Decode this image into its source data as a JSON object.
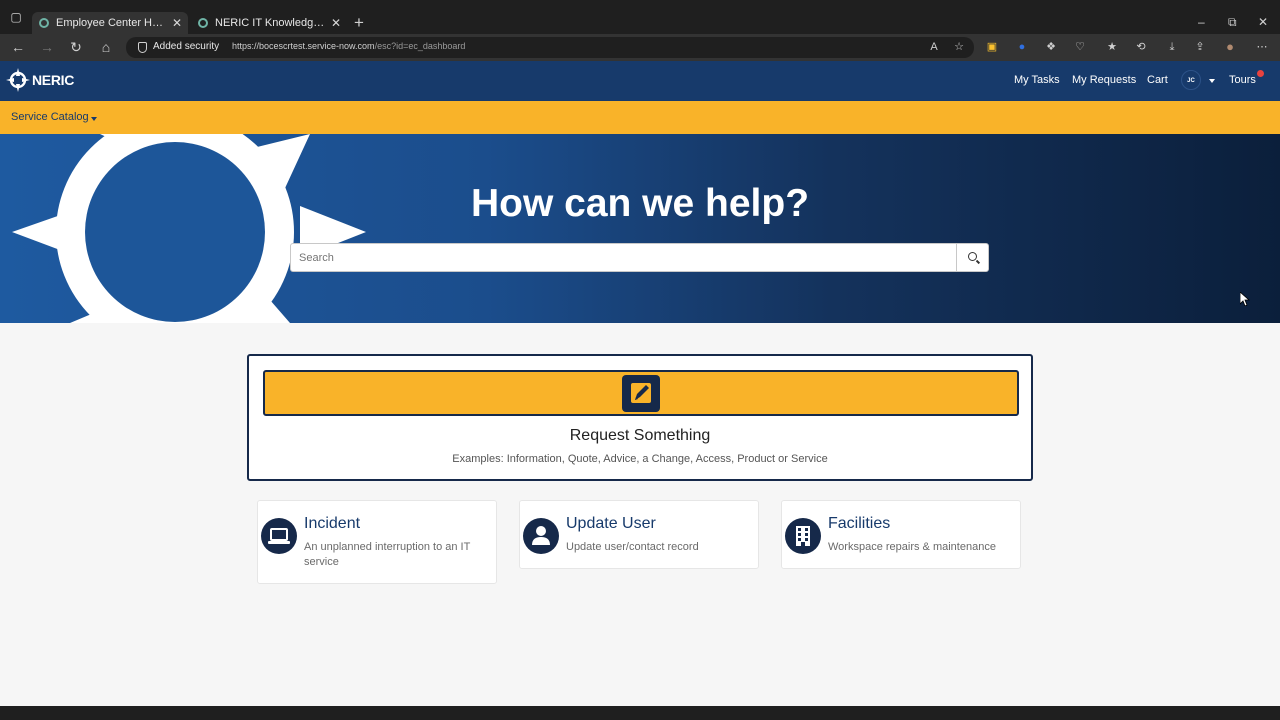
{
  "browser": {
    "tabs": [
      {
        "title": "Employee Center Homepage - E",
        "close": "✕",
        "active": true
      },
      {
        "title": "NERIC IT Knowledge Base - NER",
        "close": "✕",
        "active": false
      }
    ],
    "new_tab": "+",
    "window_controls": {
      "minimize": "–",
      "restore": "⧉",
      "close": "✕"
    },
    "security_label": "Added security",
    "url_host": "https://bocescrtest.service-now.com",
    "url_path": "/esc?id=ec_dashboard",
    "nav_icons": {
      "back": "←",
      "forward": "→",
      "reload": "↻",
      "home": "⌂"
    },
    "toolbar_icons": [
      {
        "name": "read-aloud-icon",
        "glyph": "A"
      },
      {
        "name": "favorite-add-icon",
        "glyph": "☆"
      },
      {
        "name": "extension-icon",
        "glyph": "▣"
      },
      {
        "name": "extension-blue-icon",
        "glyph": "●"
      },
      {
        "name": "extensions-icon",
        "glyph": "❖"
      },
      {
        "name": "browser-essentials-icon",
        "glyph": "♡"
      },
      {
        "name": "favorites-icon",
        "glyph": "★"
      },
      {
        "name": "history-icon",
        "glyph": "⟲"
      },
      {
        "name": "downloads-icon",
        "glyph": "⤓"
      },
      {
        "name": "share-icon",
        "glyph": "⇪"
      },
      {
        "name": "profile-icon",
        "glyph": "●"
      },
      {
        "name": "more-icon",
        "glyph": "⋯"
      }
    ]
  },
  "header": {
    "logo_text": "NERIC",
    "links": [
      "My Tasks",
      "My Requests",
      "Cart"
    ],
    "avatar_initials": "JC",
    "tours_label": "Tours"
  },
  "catalog_bar": {
    "menu_label": "Service Catalog"
  },
  "hero": {
    "title": "How can we help?",
    "search_placeholder": "Search"
  },
  "request_card": {
    "title": "Request Something",
    "subtitle": "Examples: Information, Quote, Advice, a Change, Access, Product or Service"
  },
  "tiles": [
    {
      "title": "Incident",
      "description": "An unplanned interruption to an IT service",
      "icon": "laptop-icon"
    },
    {
      "title": "Update User",
      "description": "Update user/contact record",
      "icon": "user-icon"
    },
    {
      "title": "Facilities",
      "description": "Workspace repairs & maintenance",
      "icon": "building-icon"
    }
  ],
  "colors": {
    "header_navy": "#173a6b",
    "accent_gold": "#f9b329",
    "card_navy": "#16294a"
  }
}
